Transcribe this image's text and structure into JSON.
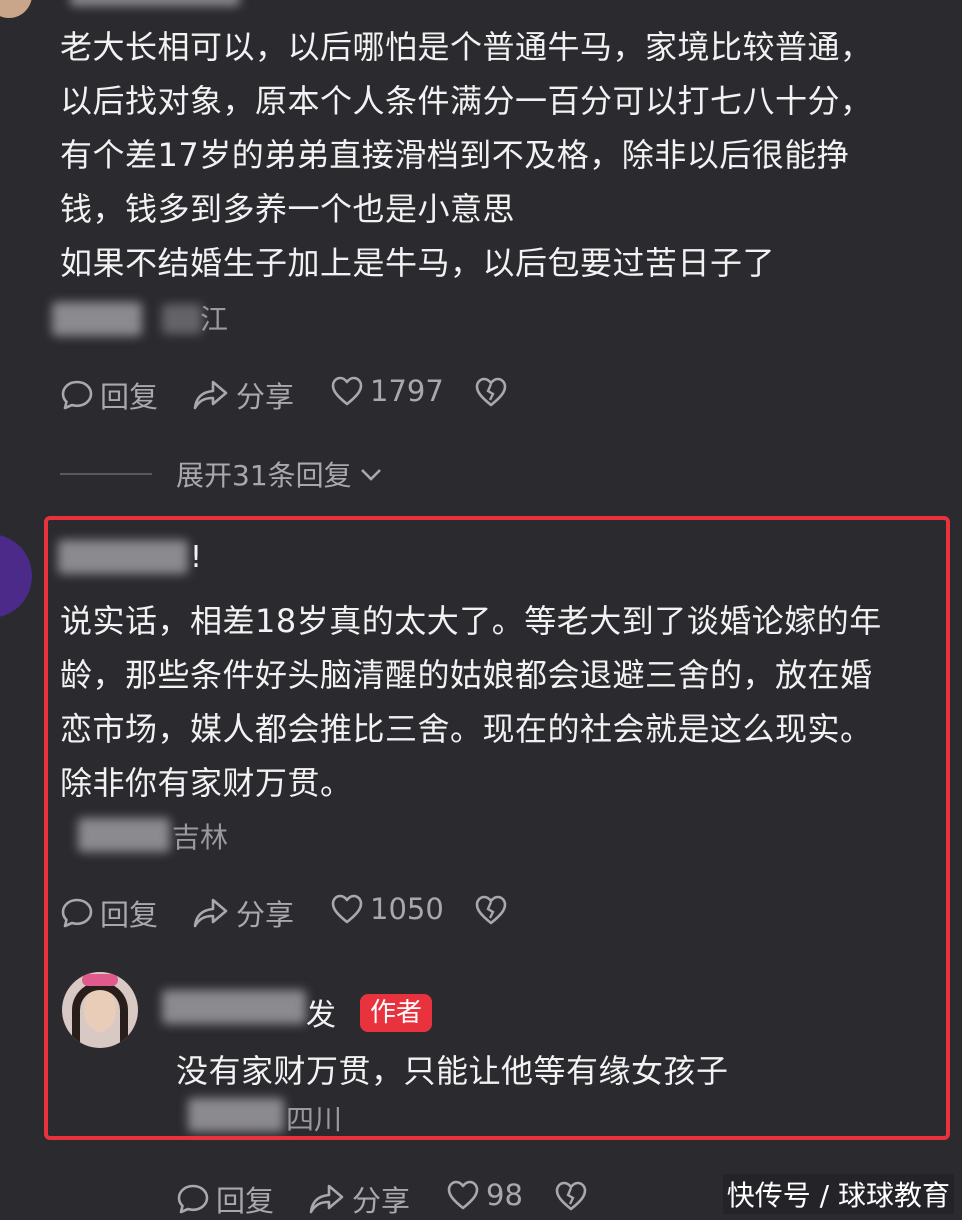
{
  "comment1": {
    "text_lines": [
      "老大长相可以，以后哪怕是个普通牛马，家境比较普通，",
      "以后找对象，原本个人条件满分一百分可以打七八十分，",
      "有个差17岁的弟弟直接滑档到不及格，除非以后很能挣",
      "钱，钱多到多养一个也是小意思",
      "如果不结婚生子加上是牛马，以后包要过苦日子了"
    ],
    "location": "江",
    "reply_label": "回复",
    "share_label": "分享",
    "like_count": "1797"
  },
  "expand_replies": "展开31条回复",
  "comment2": {
    "username_visible": "!",
    "text_lines": [
      "说实话，相差18岁真的太大了。等老大到了谈婚论嫁的年",
      "龄，那些条件好头脑清醒的姑娘都会退避三舍的，放在婚",
      "恋市场，媒人都会推比三舍。现在的社会就是这么现实。",
      "除非你有家财万贯。"
    ],
    "location": "吉林",
    "reply_label": "回复",
    "share_label": "分享",
    "like_count": "1050"
  },
  "author_reply": {
    "username_visible": "发",
    "badge": "作者",
    "text": "没有家财万贯，只能让他等有缘女孩子",
    "location": "四川",
    "reply_label": "回复",
    "share_label": "分享",
    "like_count": "98"
  },
  "watermark": "快传号 / 球球教育",
  "colors": {
    "background": "#2b2a2f",
    "highlight_border": "#e8333e",
    "badge": "#e8333e"
  }
}
